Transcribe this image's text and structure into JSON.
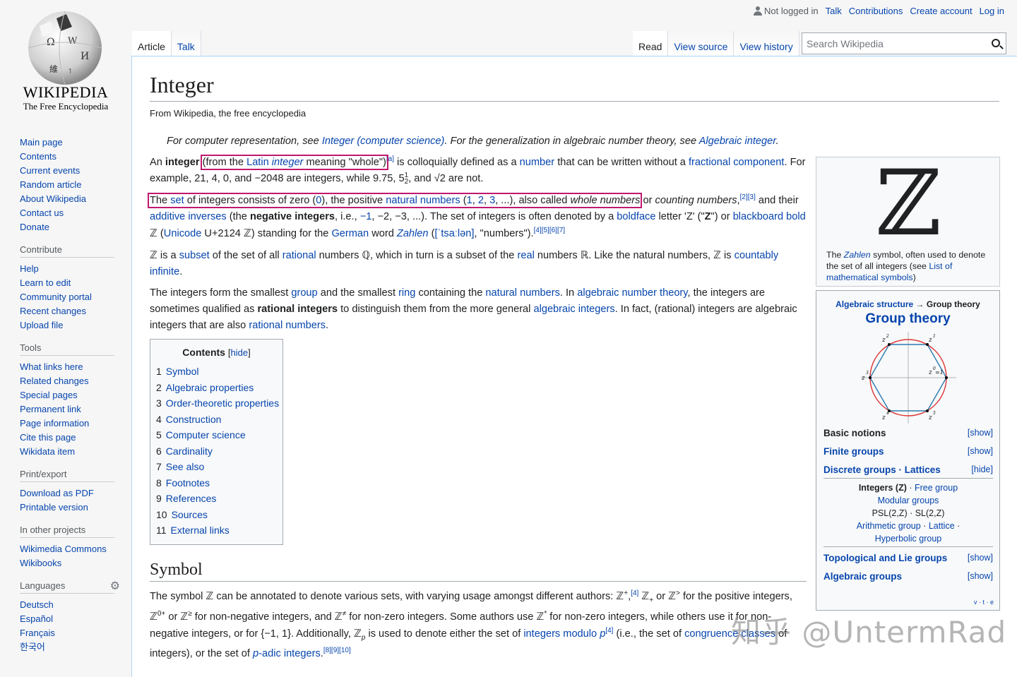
{
  "logo": {
    "wordmark": "WIKIPEDIA",
    "tagline": "The Free Encyclopedia"
  },
  "navigation": {
    "items": [
      "Main page",
      "Contents",
      "Current events",
      "Random article",
      "About Wikipedia",
      "Contact us",
      "Donate"
    ]
  },
  "contribute": {
    "heading": "Contribute",
    "items": [
      "Help",
      "Learn to edit",
      "Community portal",
      "Recent changes",
      "Upload file"
    ]
  },
  "tools": {
    "heading": "Tools",
    "items": [
      "What links here",
      "Related changes",
      "Special pages",
      "Permanent link",
      "Page information",
      "Cite this page",
      "Wikidata item"
    ]
  },
  "printexport": {
    "heading": "Print/export",
    "items": [
      "Download as PDF",
      "Printable version"
    ]
  },
  "otherprojects": {
    "heading": "In other projects",
    "items": [
      "Wikimedia Commons",
      "Wikibooks"
    ]
  },
  "languages": {
    "heading": "Languages",
    "items": [
      "Deutsch",
      "Español",
      "Français",
      "한국어"
    ]
  },
  "personal": {
    "not_logged": "Not logged in",
    "talk": "Talk",
    "contributions": "Contributions",
    "create_account": "Create account",
    "login": "Log in"
  },
  "tabs": {
    "article": "Article",
    "talk": "Talk",
    "read": "Read",
    "view_source": "View source",
    "view_history": "View history"
  },
  "search": {
    "placeholder": "Search Wikipedia"
  },
  "article": {
    "title": "Integer",
    "site_sub": "From Wikipedia, the free encyclopedia",
    "hatnote": {
      "t1": "For computer representation, see ",
      "l1": "Integer (computer science)",
      "t2": ". For the generalization in algebraic number theory, see ",
      "l2": "Algebraic integer",
      "t3": "."
    }
  },
  "zbox": {
    "symbol": "ℤ",
    "caption_1": "The ",
    "caption_link": "Zahlen",
    "caption_2": " symbol, often used to denote the set of all integers (see ",
    "caption_link2": "List of mathematical symbols",
    "caption_3": ")"
  },
  "navbox": {
    "series_link": "Algebraic structure",
    "series_rest": " → Group theory",
    "title": "Group theory",
    "diagram_labels": [
      "z",
      "2",
      "z",
      "1",
      "z",
      "3",
      "z",
      "0",
      "=1",
      "z",
      "4",
      "z",
      "5"
    ],
    "rows": [
      {
        "label": "Basic notions",
        "toggle": "[show]"
      },
      {
        "label": "Finite groups",
        "toggle": "[show]"
      },
      {
        "label": "Discrete groups · Lattices",
        "toggle": "[hide]"
      },
      {
        "label": "Topological and Lie groups",
        "toggle": "[show]"
      },
      {
        "label": "Algebraic groups",
        "toggle": "[show]"
      }
    ],
    "sub": {
      "integers": "Integers (Z)",
      "free_group": "Free group",
      "modular": "Modular groups",
      "psl": "PSL(2,Z) · SL(2,Z)",
      "arithmetic": "Arithmetic group",
      "lattice": "Lattice",
      "hyperbolic": "Hyperbolic group"
    },
    "vte": "v · t · e"
  },
  "toc": {
    "title": "Contents",
    "hide": "hide",
    "items": [
      {
        "num": "1",
        "label": "Symbol"
      },
      {
        "num": "2",
        "label": "Algebraic properties"
      },
      {
        "num": "3",
        "label": "Order-theoretic properties"
      },
      {
        "num": "4",
        "label": "Construction"
      },
      {
        "num": "5",
        "label": "Computer science"
      },
      {
        "num": "6",
        "label": "Cardinality"
      },
      {
        "num": "7",
        "label": "See also"
      },
      {
        "num": "8",
        "label": "Footnotes"
      },
      {
        "num": "9",
        "label": "References"
      },
      {
        "num": "10",
        "label": "Sources"
      },
      {
        "num": "11",
        "label": "External links"
      }
    ]
  },
  "section": {
    "symbol_heading": "Symbol"
  },
  "watermark": "知乎 @UntermRad"
}
